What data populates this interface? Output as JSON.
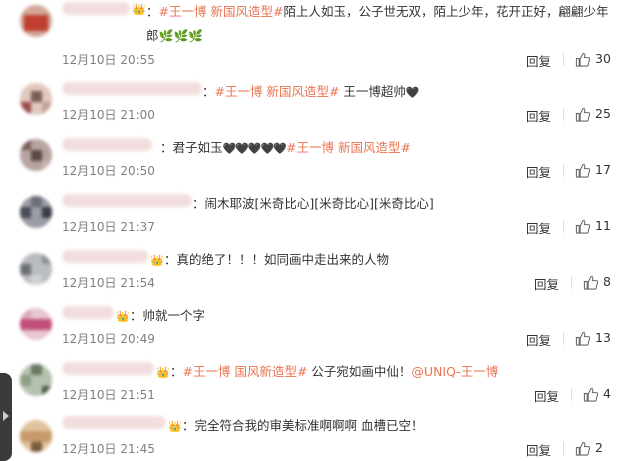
{
  "ui": {
    "reply_label": "回复"
  },
  "comments": [
    {
      "text_pre": "：",
      "tag": "#王一博 新国风造型#",
      "text_post": "陌上人如玉，公子世无双，陌上少年，花开正好，翩翩少年郎",
      "emoji": "🌿🌿🌿",
      "time": "12月10日 20:55",
      "likes": "30",
      "avatar_colors": [
        "#c0402f",
        "#c9503a",
        "#b84a3d",
        "#d65a48"
      ]
    },
    {
      "text_pre": "：",
      "tag": "#王一博 新国风造型#",
      "text_post": " 王一博超帅",
      "emoji": "🖤",
      "time": "12月10日 21:00",
      "likes": "25",
      "avatar_colors": [
        "#e0c9bd",
        "#7a5d56",
        "#c4a198",
        "#9b4c4c"
      ]
    },
    {
      "text_pre": "：君子如玉",
      "emoji": "🖤🖤🖤🖤🖤",
      "tag": "#王一博 新国风造型#",
      "text_post": "",
      "time": "12月10日 20:50",
      "likes": "17",
      "avatar_colors": [
        "#7a5f5a",
        "#b8a3a0",
        "#5a4a4a",
        "#cbb2ae"
      ]
    },
    {
      "text_pre": "：闹木耶波[米奇比心][米奇比心][米奇比心]",
      "tag": "",
      "text_post": "",
      "emoji": "",
      "time": "12月10日 21:37",
      "likes": "11",
      "avatar_colors": [
        "#6d6f78",
        "#9a9ca4",
        "#4a4d57",
        "#b9bcc4"
      ]
    },
    {
      "text_pre": "：真的绝了！！！如同画中走出来的人物",
      "tag": "",
      "text_post": "",
      "emoji": "",
      "time": "12月10日 21:54",
      "likes": "8",
      "avatar_colors": [
        "#8c8f94",
        "#b9bcc0",
        "#6d7075",
        "#d0d2d5"
      ]
    },
    {
      "text_pre": "：帅就一个字",
      "tag": "",
      "text_post": "",
      "emoji": "",
      "time": "12月10日 20:49",
      "likes": "13",
      "avatar_colors": [
        "#d9a7b8",
        "#c24f7a",
        "#e8c7d2",
        "#b03a68"
      ]
    },
    {
      "text_pre": "：",
      "tag": "#王一博 国风新造型#",
      "text_post": " 公子宛如画中仙！",
      "mention": "@UNIQ-王一博",
      "emoji": "",
      "time": "12月10日 21:51",
      "likes": "4",
      "avatar_colors": [
        "#8e9e86",
        "#6b7a63",
        "#b5c2ae",
        "#4f5c48"
      ]
    },
    {
      "text_pre": "：完全符合我的审美标准啊啊啊 血槽已空！",
      "tag": "",
      "text_post": "",
      "emoji": "",
      "time": "12月10日 21:45",
      "likes": "2",
      "avatar_colors": [
        "#c89a6a",
        "#9b7a55",
        "#e0c49e",
        "#7a5a3a"
      ]
    }
  ]
}
